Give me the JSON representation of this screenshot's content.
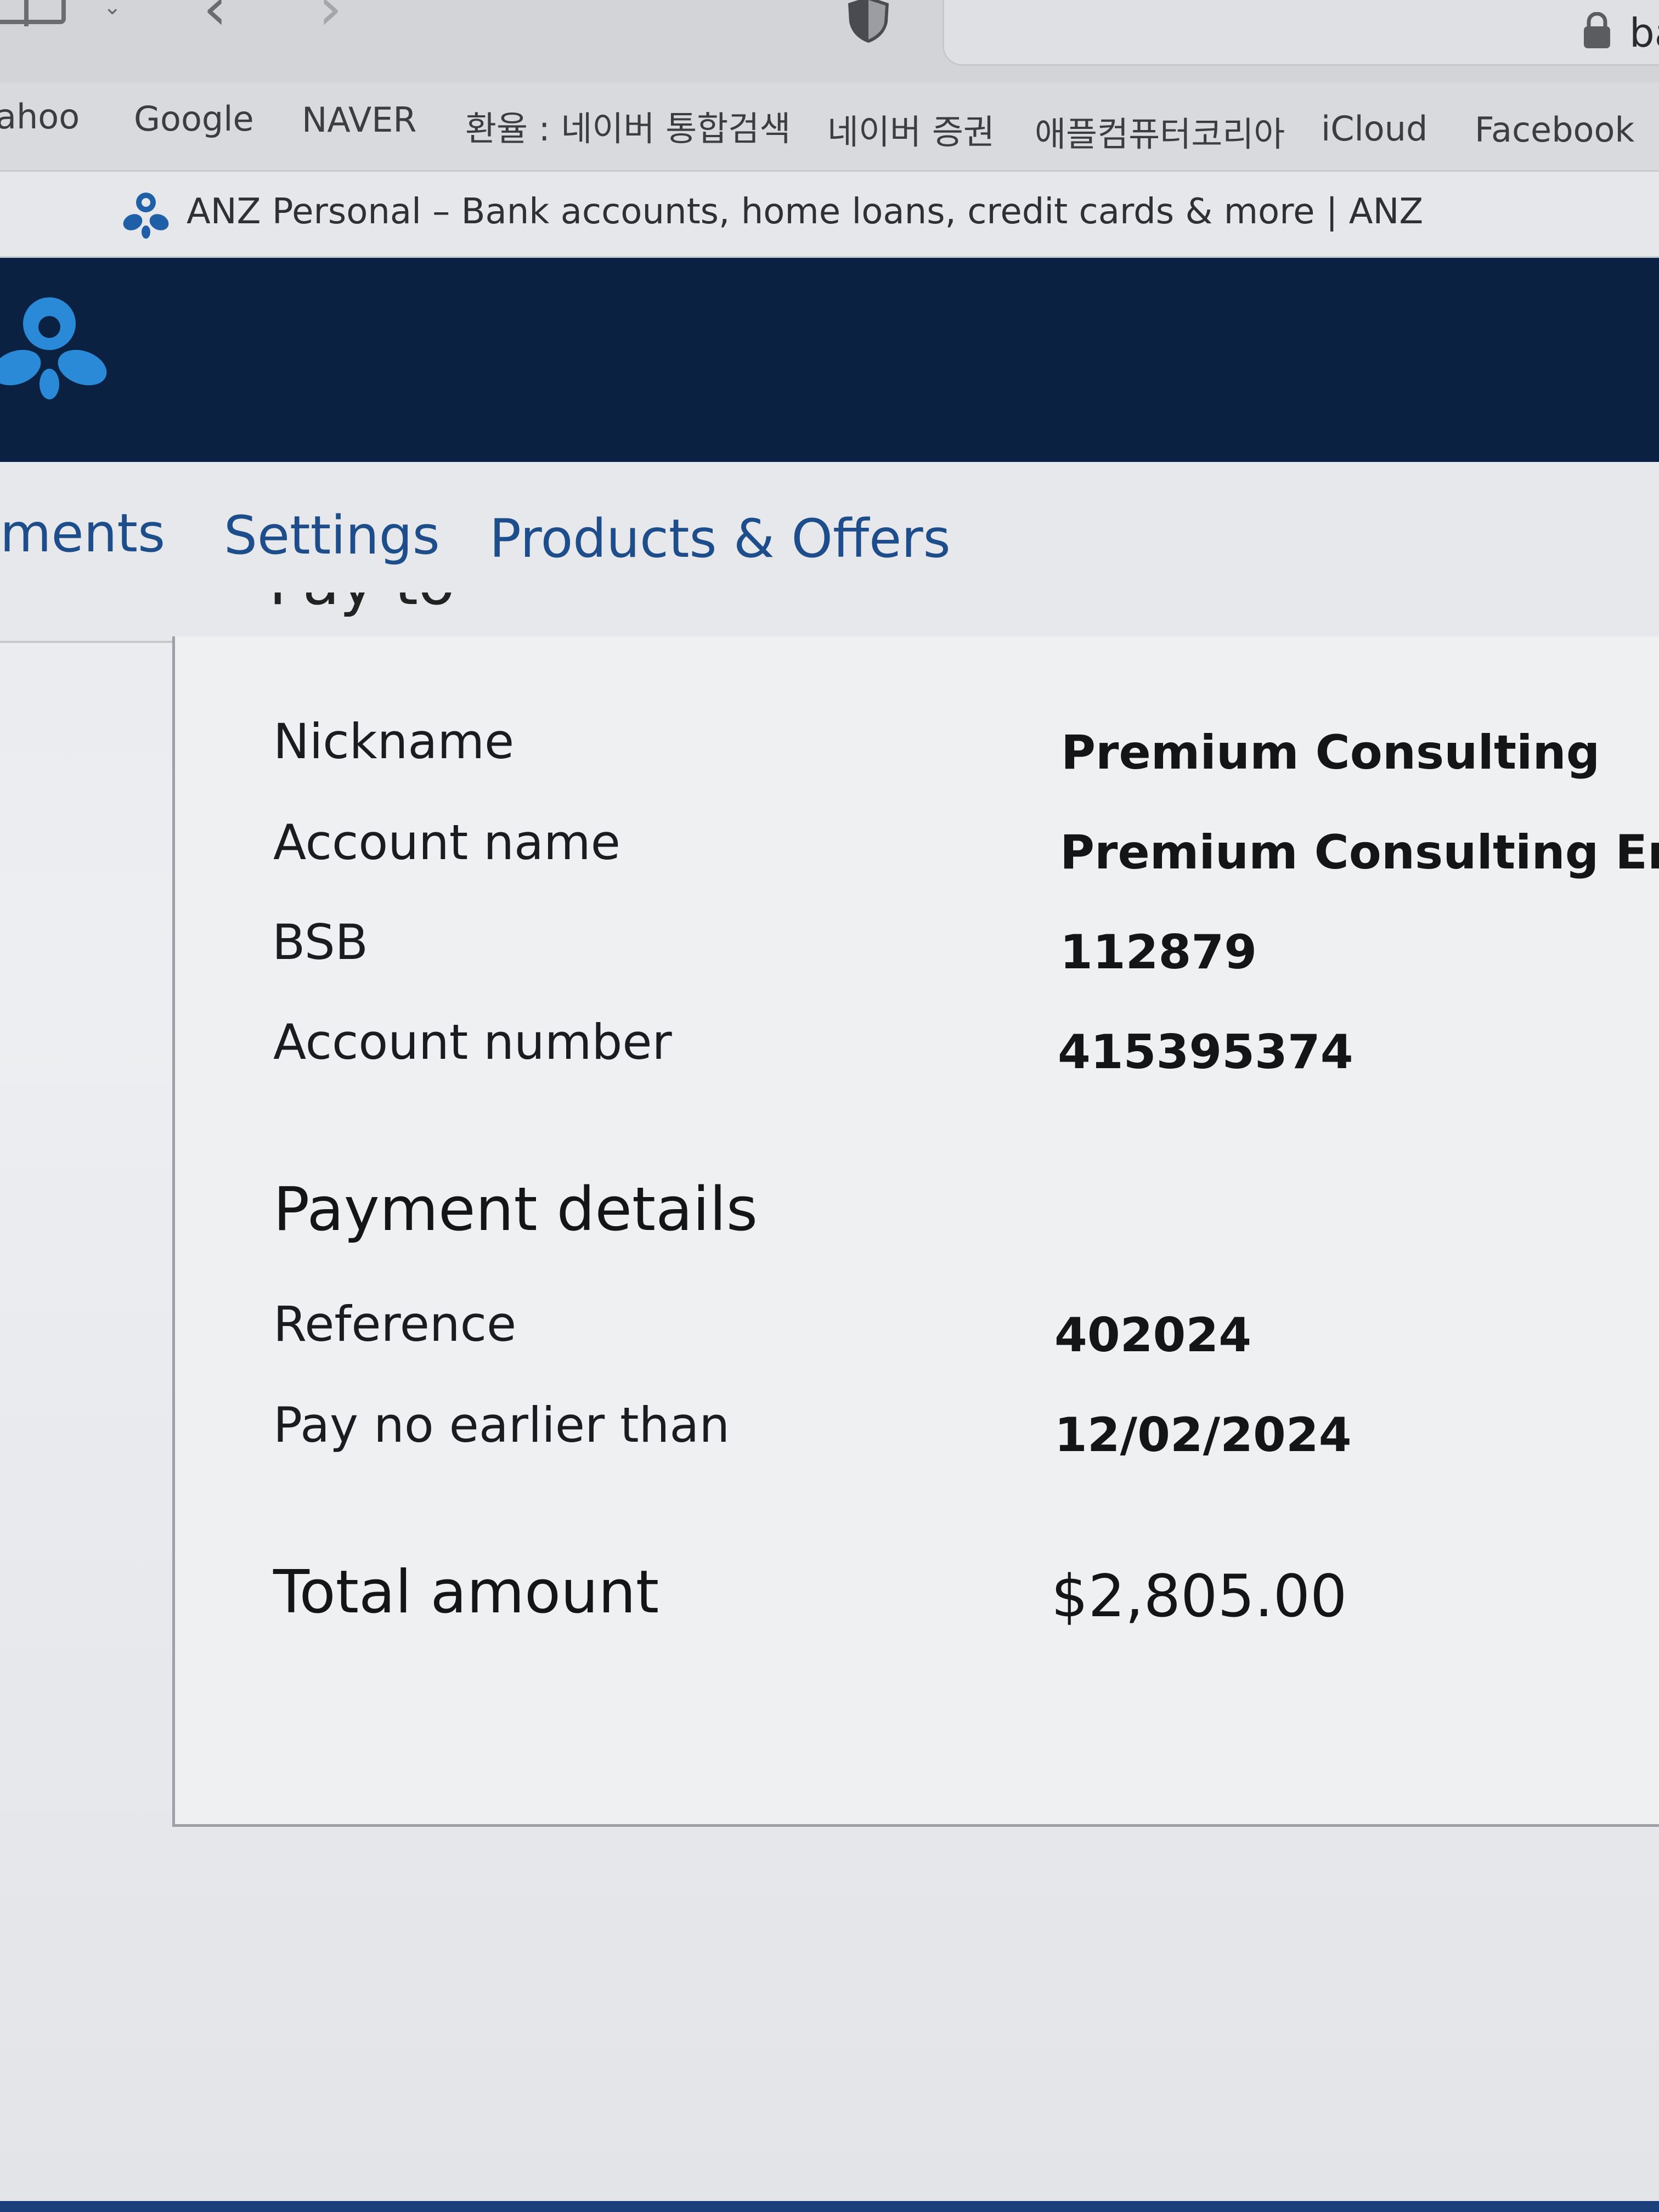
{
  "browser": {
    "url_fragment": "ba",
    "favorites": [
      "ahoo",
      "Google",
      "NAVER",
      "환율 : 네이버 통합검색",
      "네이버 증권",
      "애플컴퓨터코리아",
      "iCloud",
      "Facebook"
    ],
    "tab_title": "ANZ Personal – Bank accounts, home loans, credit cards & more | ANZ"
  },
  "nav": {
    "items": [
      "ments",
      "Settings",
      "Products & Offers"
    ]
  },
  "pay_to": {
    "heading": "Pay to",
    "rows": [
      {
        "label": "Nickname",
        "value": "Premium Consulting"
      },
      {
        "label": "Account name",
        "value": "Premium Consulting Enginee"
      },
      {
        "label": "BSB",
        "value": "112879"
      },
      {
        "label": "Account number",
        "value": "415395374"
      }
    ]
  },
  "payment_details": {
    "heading": "Payment details",
    "rows": [
      {
        "label": "Reference",
        "value": "402024"
      },
      {
        "label": "Pay no earlier than",
        "value": "12/02/2024"
      }
    ]
  },
  "total": {
    "label": "Total amount",
    "value": "$2,805.00"
  },
  "colors": {
    "brand_navy": "#0b2142",
    "brand_blue": "#2a8ad8",
    "nav_link": "#1d4d8a"
  }
}
